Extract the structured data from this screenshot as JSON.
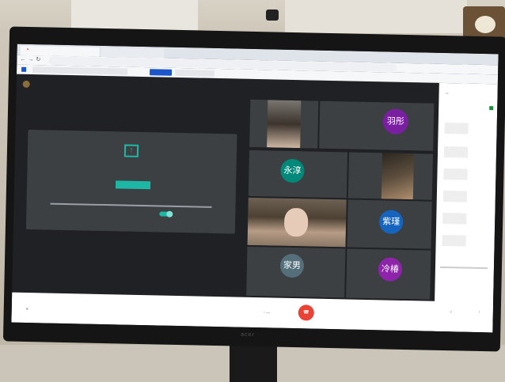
{
  "browser": {
    "tabs": [
      "",
      ""
    ],
    "url": "",
    "bookmark_highlight": ""
  },
  "meeting": {
    "title": "",
    "presentation": {
      "message": "",
      "button": "",
      "control_label": ""
    },
    "participants": [
      {
        "avatar_text": "羽彤",
        "color": "#7b1fa2"
      },
      {
        "avatar_text": "永淳",
        "color": "#00897b"
      },
      {
        "avatar_text": "紫瑾",
        "color": "#1565c0"
      },
      {
        "avatar_text": "家男",
        "color": "#546e7a"
      },
      {
        "avatar_text": "冷椿",
        "color": "#8e24aa"
      }
    ],
    "monitor_brand": "acer"
  },
  "colors": {
    "accent": "#1eb7a5",
    "leave": "#ea4335",
    "meet_bg": "#202124",
    "tile_bg": "#3c4043"
  }
}
